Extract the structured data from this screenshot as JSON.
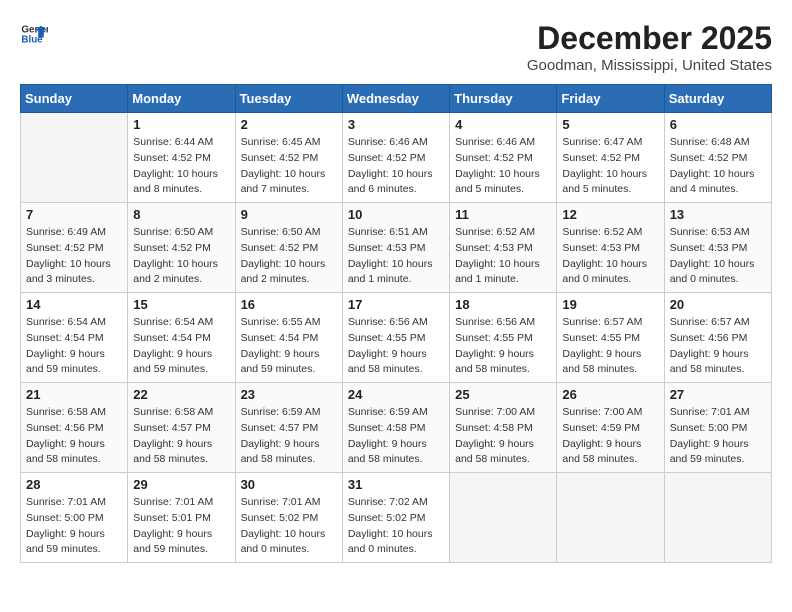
{
  "header": {
    "logo_line1": "General",
    "logo_line2": "Blue",
    "title": "December 2025",
    "subtitle": "Goodman, Mississippi, United States"
  },
  "weekdays": [
    "Sunday",
    "Monday",
    "Tuesday",
    "Wednesday",
    "Thursday",
    "Friday",
    "Saturday"
  ],
  "weeks": [
    [
      {
        "day": "",
        "empty": true
      },
      {
        "day": "1",
        "sunrise": "6:44 AM",
        "sunset": "4:52 PM",
        "daylight": "10 hours and 8 minutes."
      },
      {
        "day": "2",
        "sunrise": "6:45 AM",
        "sunset": "4:52 PM",
        "daylight": "10 hours and 7 minutes."
      },
      {
        "day": "3",
        "sunrise": "6:46 AM",
        "sunset": "4:52 PM",
        "daylight": "10 hours and 6 minutes."
      },
      {
        "day": "4",
        "sunrise": "6:46 AM",
        "sunset": "4:52 PM",
        "daylight": "10 hours and 5 minutes."
      },
      {
        "day": "5",
        "sunrise": "6:47 AM",
        "sunset": "4:52 PM",
        "daylight": "10 hours and 5 minutes."
      },
      {
        "day": "6",
        "sunrise": "6:48 AM",
        "sunset": "4:52 PM",
        "daylight": "10 hours and 4 minutes."
      }
    ],
    [
      {
        "day": "7",
        "sunrise": "6:49 AM",
        "sunset": "4:52 PM",
        "daylight": "10 hours and 3 minutes."
      },
      {
        "day": "8",
        "sunrise": "6:50 AM",
        "sunset": "4:52 PM",
        "daylight": "10 hours and 2 minutes."
      },
      {
        "day": "9",
        "sunrise": "6:50 AM",
        "sunset": "4:52 PM",
        "daylight": "10 hours and 2 minutes."
      },
      {
        "day": "10",
        "sunrise": "6:51 AM",
        "sunset": "4:53 PM",
        "daylight": "10 hours and 1 minute."
      },
      {
        "day": "11",
        "sunrise": "6:52 AM",
        "sunset": "4:53 PM",
        "daylight": "10 hours and 1 minute."
      },
      {
        "day": "12",
        "sunrise": "6:52 AM",
        "sunset": "4:53 PM",
        "daylight": "10 hours and 0 minutes."
      },
      {
        "day": "13",
        "sunrise": "6:53 AM",
        "sunset": "4:53 PM",
        "daylight": "10 hours and 0 minutes."
      }
    ],
    [
      {
        "day": "14",
        "sunrise": "6:54 AM",
        "sunset": "4:54 PM",
        "daylight": "9 hours and 59 minutes."
      },
      {
        "day": "15",
        "sunrise": "6:54 AM",
        "sunset": "4:54 PM",
        "daylight": "9 hours and 59 minutes."
      },
      {
        "day": "16",
        "sunrise": "6:55 AM",
        "sunset": "4:54 PM",
        "daylight": "9 hours and 59 minutes."
      },
      {
        "day": "17",
        "sunrise": "6:56 AM",
        "sunset": "4:55 PM",
        "daylight": "9 hours and 58 minutes."
      },
      {
        "day": "18",
        "sunrise": "6:56 AM",
        "sunset": "4:55 PM",
        "daylight": "9 hours and 58 minutes."
      },
      {
        "day": "19",
        "sunrise": "6:57 AM",
        "sunset": "4:55 PM",
        "daylight": "9 hours and 58 minutes."
      },
      {
        "day": "20",
        "sunrise": "6:57 AM",
        "sunset": "4:56 PM",
        "daylight": "9 hours and 58 minutes."
      }
    ],
    [
      {
        "day": "21",
        "sunrise": "6:58 AM",
        "sunset": "4:56 PM",
        "daylight": "9 hours and 58 minutes."
      },
      {
        "day": "22",
        "sunrise": "6:58 AM",
        "sunset": "4:57 PM",
        "daylight": "9 hours and 58 minutes."
      },
      {
        "day": "23",
        "sunrise": "6:59 AM",
        "sunset": "4:57 PM",
        "daylight": "9 hours and 58 minutes."
      },
      {
        "day": "24",
        "sunrise": "6:59 AM",
        "sunset": "4:58 PM",
        "daylight": "9 hours and 58 minutes."
      },
      {
        "day": "25",
        "sunrise": "7:00 AM",
        "sunset": "4:58 PM",
        "daylight": "9 hours and 58 minutes."
      },
      {
        "day": "26",
        "sunrise": "7:00 AM",
        "sunset": "4:59 PM",
        "daylight": "9 hours and 58 minutes."
      },
      {
        "day": "27",
        "sunrise": "7:01 AM",
        "sunset": "5:00 PM",
        "daylight": "9 hours and 59 minutes."
      }
    ],
    [
      {
        "day": "28",
        "sunrise": "7:01 AM",
        "sunset": "5:00 PM",
        "daylight": "9 hours and 59 minutes."
      },
      {
        "day": "29",
        "sunrise": "7:01 AM",
        "sunset": "5:01 PM",
        "daylight": "9 hours and 59 minutes."
      },
      {
        "day": "30",
        "sunrise": "7:01 AM",
        "sunset": "5:02 PM",
        "daylight": "10 hours and 0 minutes."
      },
      {
        "day": "31",
        "sunrise": "7:02 AM",
        "sunset": "5:02 PM",
        "daylight": "10 hours and 0 minutes."
      },
      {
        "day": "",
        "empty": true
      },
      {
        "day": "",
        "empty": true
      },
      {
        "day": "",
        "empty": true
      }
    ]
  ]
}
